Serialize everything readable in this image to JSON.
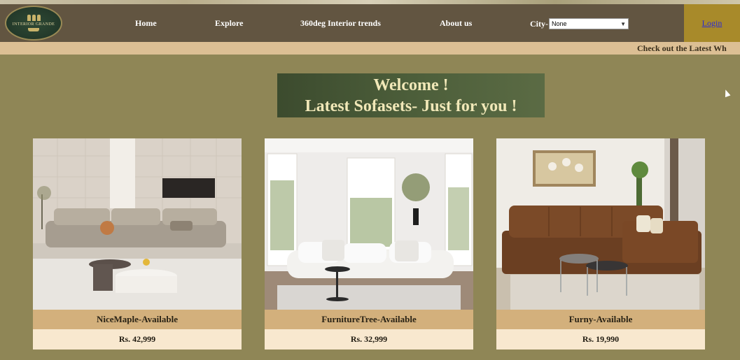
{
  "brand": {
    "logo_text": "INTERIOR GRANDE"
  },
  "nav": {
    "items": [
      {
        "label": "Home"
      },
      {
        "label": "Explore"
      },
      {
        "label": "360deg Interior trends"
      },
      {
        "label": "About us"
      }
    ],
    "city_label": "City-",
    "city_selected": "None",
    "login_label": "Login"
  },
  "marquee": {
    "text": "Check out the Latest Wh"
  },
  "welcome": {
    "line1": "Welcome !",
    "line2": "Latest Sofasets- Just for you !"
  },
  "products": [
    {
      "name": "NiceMaple-Available",
      "price": "Rs. 42,999",
      "image": "grey-sofa-living-room-image"
    },
    {
      "name": "FurnitureTree-Available",
      "price": "Rs. 32,999",
      "image": "white-sofa-bright-room-image"
    },
    {
      "name": "Furny-Available",
      "price": "Rs. 19,990",
      "image": "brown-leather-sectional-sofa-image"
    }
  ],
  "colors": {
    "page_bg": "#8f8656",
    "navbar_bg": "#625541",
    "login_bg": "#a88a2a",
    "marquee_bg": "#dcbf94",
    "card_name_bg": "#d3b07c",
    "card_price_bg": "#f8e8cf"
  }
}
